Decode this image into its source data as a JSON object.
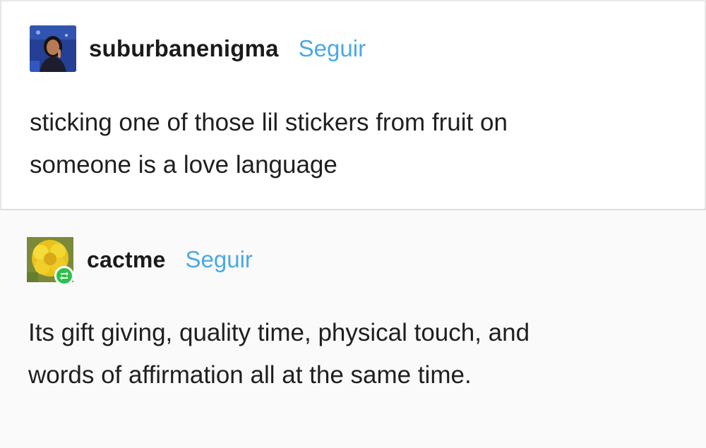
{
  "posts": [
    {
      "username": "suburbanenigma",
      "follow_label": "Seguir",
      "avatar_icon": "user-avatar-photo-icon",
      "lines": [
        "sticking one of those lil stickers from fruit on",
        "someone is a love language"
      ]
    },
    {
      "username": "cactme",
      "follow_label": "Seguir",
      "avatar_icon": "user-avatar-flower-icon",
      "reblog_icon": "reblog-icon",
      "lines": [
        "Its gift giving, quality time, physical touch, and",
        "words of affirmation all at the same time."
      ]
    }
  ],
  "colors": {
    "follow_link": "#4aa9e6",
    "reblog_badge": "#2bc14a",
    "text": "#1f1f1f"
  }
}
